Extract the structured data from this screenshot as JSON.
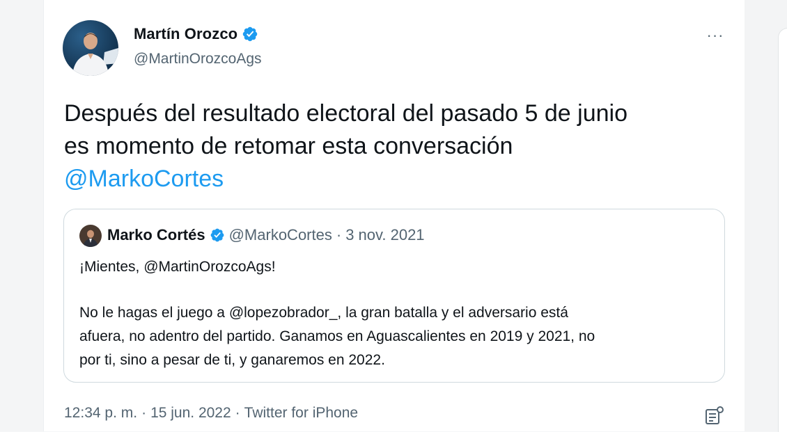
{
  "author": {
    "display_name": "Martín Orozco",
    "handle": "@MartinOrozcoAgs",
    "verified": true,
    "avatar_icon": "profile-photo"
  },
  "tweet": {
    "line1": "Después del resultado electoral del pasado 5 de junio",
    "line2": "es momento de retomar esta conversación",
    "mention": "@MarkoCortes"
  },
  "quoted_tweet": {
    "display_name": "Marko Cortés",
    "handle": "@MarkoCortes",
    "separator": "·",
    "date": "3 nov. 2021",
    "paragraph1": "¡Mientes, @MartinOrozcoAgs!",
    "paragraph2_line1": "No le hagas el juego a @lopezobrador_, la gran batalla y el adversario está",
    "paragraph2_line2": "afuera, no adentro del partido. Ganamos en Aguascalientes en 2019 y 2021, no",
    "paragraph2_line3": "por ti, sino a pesar de ti, y ganaremos en 2022."
  },
  "meta": {
    "time": "12:34 p. m.",
    "sep1": "·",
    "date": "15 jun. 2022",
    "sep2": "·",
    "source": "Twitter for iPhone"
  },
  "more_menu": {
    "label": "···"
  },
  "colors": {
    "accent": "#1d9bf0",
    "secondary_text": "#536471",
    "primary_text": "#0f1419",
    "border": "#cfd9de"
  }
}
